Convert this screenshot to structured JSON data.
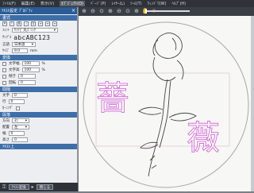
{
  "menubar": [
    "ﾌｧｲﾙ(F)",
    "編集(E)",
    "表示(V)",
    "ｵﾌﾞｼﾞｪｸﾄ(O)",
    "ﾍﾟｰｼﾞ(P)",
    "ﾚｲﾔｰ(L)",
    "ﾂｰﾙ(T)",
    "ｳｨﾝﾄﾞｳ(W)",
    "ﾍﾙﾌﾟ(H)"
  ],
  "panel": {
    "title": "ﾃｷｽﾄ設定 ﾌﾟﾛﾊﾟﾃｨ",
    "sections": {
      "style": "書式",
      "transform": "変換",
      "spacing": "間隔",
      "direction": "段落",
      "bottom": "ﾃｷｽﾄ上"
    },
    "font_label": "ﾌｫﾝﾄ",
    "font_value": "ｾﾌｲﾋﾞ丸ｺﾞｼｯｸ",
    "sample_label": "ｻﾝﾌﾟﾙ",
    "sample_text": "abcABC123",
    "lang_label": "言語",
    "lang_value": "日本語",
    "size_label": "ｻｲｽﾞ",
    "size_value": "9.0",
    "size_unit": "mm",
    "width_label": "文字幅",
    "width_value": "100",
    "height_label": "文字高",
    "height_value": "100",
    "slant_label": "傾き",
    "slant_value": "0",
    "rot_label": "回転",
    "rot_value": "0",
    "char_label": "文字",
    "char_value": "0",
    "line_label": "行",
    "line_value": "0",
    "kern_label": "ｶｰﾆﾝｸﾞ",
    "dir_label": "方向",
    "dir_value": "ﾖｺ",
    "align_label": "配置",
    "align_value": "左",
    "w_label": "幅",
    "w_value": "0",
    "h_label": "高さ",
    "h_value": "0",
    "btn_apply": "ﾃｷｽﾄ変換",
    "btn_close": "閉じる"
  },
  "canvas": {
    "char1": "薔",
    "char2": "薇"
  },
  "colors": {
    "accent": "#2b5c96",
    "glyph": "#d25fd8"
  }
}
